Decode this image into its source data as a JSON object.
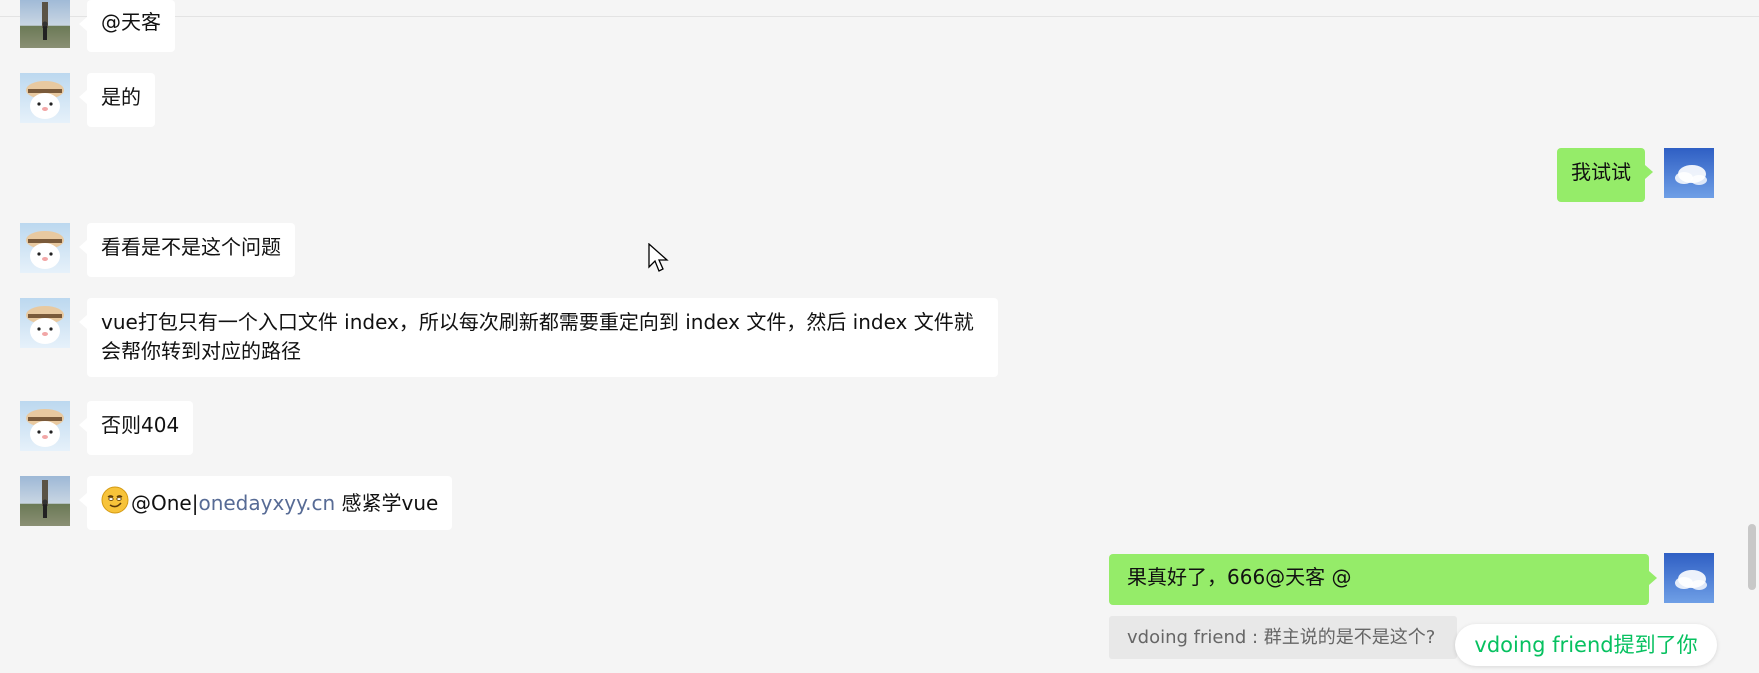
{
  "messages": [
    {
      "side": "left",
      "avatar": "person-photo-avatar",
      "text": "@天客"
    },
    {
      "side": "left",
      "avatar": "cartoon-bear-avatar",
      "text": "是的"
    },
    {
      "side": "right",
      "avatar": "sky-cloud-avatar",
      "text": "我试试"
    },
    {
      "side": "left",
      "avatar": "cartoon-bear-avatar",
      "text": "看看是不是这个问题"
    },
    {
      "side": "left",
      "avatar": "cartoon-bear-avatar",
      "text": "vue打包只有一个入口文件 index，所以每次刷新都需要重定向到 index 文件，然后 index 文件就会帮你转到对应的路径"
    },
    {
      "side": "left",
      "avatar": "cartoon-bear-avatar",
      "text": "否则404"
    },
    {
      "side": "left",
      "avatar": "person-photo-avatar",
      "emoji": "smirk-emoji",
      "text_prefix": "@One|",
      "link": "onedayxyy.cn",
      "text_suffix": " 感紧学vue"
    },
    {
      "side": "right",
      "avatar": "sky-cloud-avatar",
      "text": "果真好了，666@天客 @"
    }
  ],
  "quote": {
    "text": "vdoing friend : 群主说的是不是这个?"
  },
  "mention_notice": {
    "text": "vdoing friend提到了你"
  },
  "colors": {
    "background": "#f5f5f5",
    "bubble_left": "#ffffff",
    "bubble_right": "#95ec69",
    "link": "#576b95",
    "mention_text": "#07c160"
  }
}
